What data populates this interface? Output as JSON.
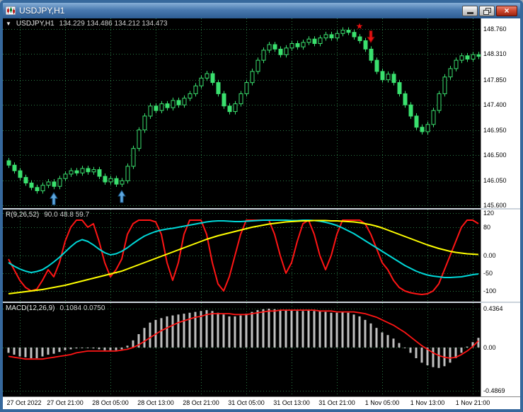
{
  "window": {
    "title": "USDJPY,H1",
    "close_glyph": "×"
  },
  "chart": {
    "collapse_icon": "▼",
    "symbol": "USDJPY,H1",
    "ohlc": "134.229 134.486 134.212 134.473"
  },
  "panes": {
    "osc": {
      "name": "R(9,26,52)",
      "values": "90.0 48.8 59.7"
    },
    "macd": {
      "name": "MACD(12,26,9)",
      "values": "0.1084 0.0750"
    }
  },
  "colors": {
    "grid": "#2a7a44",
    "candle": "#3ae06e",
    "osc_fast": "#ff1515",
    "osc_mid": "#00d8d8",
    "osc_slow": "#ffff00",
    "histogram": "#c0c0c0",
    "signal": "#ff1515",
    "buy_arrow": "#5fa8e0",
    "sell_arrow": "#e81111",
    "titlebar": "#3a6ba1",
    "background": "#000000"
  },
  "chart_data": [
    {
      "type": "candlestick",
      "title": "USDJPY,H1",
      "x_labels": [
        "27 Oct 2022",
        "27 Oct 21:00",
        "28 Oct 05:00",
        "28 Oct 13:00",
        "28 Oct 21:00",
        "31 Oct 05:00",
        "31 Oct 13:00",
        "31 Oct 21:00",
        "1 Nov 05:00",
        "1 Nov 13:00",
        "1 Nov 21:00"
      ],
      "x_label_bars": [
        2,
        10,
        18,
        26,
        34,
        42,
        50,
        58,
        66,
        74,
        82
      ],
      "y_ticks": [
        "148.760",
        "148.310",
        "147.850",
        "147.400",
        "146.950",
        "146.500",
        "146.050",
        "145.600"
      ],
      "y_range": [
        145.55,
        148.95
      ],
      "open_first": 146.4,
      "wick": 0.05,
      "closes": [
        146.32,
        146.22,
        146.1,
        146.0,
        145.92,
        145.86,
        145.96,
        146.02,
        145.94,
        146.08,
        146.16,
        146.22,
        146.18,
        146.26,
        146.2,
        146.24,
        146.12,
        146.02,
        146.08,
        145.98,
        146.04,
        146.3,
        146.62,
        146.95,
        147.2,
        147.38,
        147.3,
        147.42,
        147.35,
        147.48,
        147.4,
        147.52,
        147.6,
        147.74,
        147.88,
        147.96,
        147.8,
        147.6,
        147.38,
        147.28,
        147.42,
        147.6,
        147.8,
        148.0,
        148.2,
        148.38,
        148.48,
        148.4,
        148.3,
        148.42,
        148.5,
        148.44,
        148.52,
        148.58,
        148.5,
        148.6,
        148.66,
        148.6,
        148.68,
        148.74,
        148.7,
        148.62,
        148.55,
        148.4,
        148.2,
        148.0,
        147.85,
        147.95,
        147.8,
        147.6,
        147.4,
        147.2,
        147.0,
        146.92,
        147.05,
        147.3,
        147.6,
        147.9,
        148.05,
        148.2,
        148.28,
        148.22,
        148.3,
        148.27
      ],
      "markers": [
        {
          "type": "buy-arrow",
          "bar": 8,
          "color": "#5fa8e0"
        },
        {
          "type": "buy-arrow",
          "bar": 20,
          "color": "#5fa8e0"
        },
        {
          "type": "star",
          "bar": 62,
          "color": "#e81111",
          "glyph": "★"
        },
        {
          "type": "sell-arrow",
          "bar": 64,
          "color": "#e81111"
        }
      ]
    },
    {
      "type": "line",
      "label": "R(9,26,52)",
      "current_values": "90.0 48.8 59.7",
      "y_ticks": [
        "120",
        "80",
        "0.00",
        "-50",
        "-100"
      ],
      "y_range": [
        -130,
        130
      ],
      "series": [
        {
          "name": "fast",
          "color": "#ff1515",
          "values": [
            -10,
            -40,
            -70,
            -90,
            -100,
            -95,
            -70,
            -40,
            -60,
            -20,
            40,
            80,
            100,
            100,
            80,
            90,
            40,
            -20,
            -60,
            -40,
            -10,
            60,
            90,
            100,
            100,
            100,
            95,
            60,
            -20,
            -70,
            -20,
            60,
            100,
            100,
            100,
            60,
            -20,
            -80,
            -100,
            -60,
            0,
            60,
            100,
            100,
            100,
            100,
            100,
            60,
            0,
            -50,
            -20,
            40,
            90,
            100,
            60,
            0,
            -40,
            0,
            60,
            100,
            100,
            100,
            100,
            90,
            60,
            20,
            -20,
            -40,
            -70,
            -90,
            -100,
            -105,
            -108,
            -110,
            -108,
            -100,
            -80,
            -40,
            0,
            40,
            80,
            100,
            100,
            90
          ]
        },
        {
          "name": "mid",
          "color": "#00d8d8",
          "values": [
            -20,
            -30,
            -38,
            -44,
            -48,
            -45,
            -40,
            -30,
            -18,
            -5,
            10,
            25,
            38,
            45,
            40,
            30,
            18,
            8,
            2,
            5,
            12,
            22,
            34,
            45,
            55,
            62,
            68,
            72,
            75,
            77,
            80,
            83,
            86,
            89,
            92,
            95,
            97,
            98,
            98,
            97,
            96,
            96,
            97,
            98,
            99,
            100,
            100,
            100,
            100,
            100,
            99,
            99,
            100,
            100,
            99,
            97,
            94,
            90,
            85,
            78,
            70,
            62,
            52,
            42,
            32,
            22,
            12,
            2,
            -8,
            -18,
            -28,
            -36,
            -44,
            -50,
            -55,
            -58,
            -60,
            -62,
            -62,
            -61,
            -60,
            -57,
            -54,
            -52
          ]
        },
        {
          "name": "slow",
          "color": "#ffff00",
          "values": [
            -108,
            -106,
            -104,
            -102,
            -100,
            -98,
            -96,
            -93,
            -90,
            -87,
            -84,
            -80,
            -76,
            -72,
            -68,
            -64,
            -60,
            -56,
            -52,
            -48,
            -44,
            -38,
            -32,
            -26,
            -20,
            -14,
            -8,
            -2,
            4,
            10,
            16,
            22,
            28,
            34,
            40,
            46,
            51,
            56,
            60,
            64,
            68,
            72,
            76,
            80,
            83,
            86,
            89,
            91,
            93,
            95,
            96,
            97,
            98,
            98,
            99,
            99,
            99,
            98,
            98,
            97,
            96,
            95,
            93,
            90,
            87,
            83,
            78,
            72,
            66,
            60,
            54,
            48,
            42,
            36,
            30,
            25,
            20,
            16,
            12,
            9,
            7,
            5,
            4,
            3
          ]
        }
      ]
    },
    {
      "type": "macd",
      "label": "MACD(12,26,9)",
      "current_values": "0.1084 0.0750",
      "y_ticks": [
        "0.4364",
        "0.00",
        "-0.4869"
      ],
      "y_range": [
        -0.55,
        0.5
      ],
      "histogram": {
        "color": "#c0c0c0",
        "values": [
          -0.06,
          -0.08,
          -0.1,
          -0.11,
          -0.12,
          -0.12,
          -0.1,
          -0.08,
          -0.07,
          -0.05,
          -0.03,
          -0.02,
          -0.01,
          0.0,
          0.0,
          -0.01,
          -0.02,
          -0.03,
          -0.03,
          -0.03,
          -0.02,
          0.02,
          0.08,
          0.15,
          0.22,
          0.28,
          0.31,
          0.33,
          0.35,
          0.36,
          0.37,
          0.38,
          0.39,
          0.4,
          0.41,
          0.42,
          0.41,
          0.39,
          0.37,
          0.35,
          0.35,
          0.36,
          0.38,
          0.4,
          0.42,
          0.43,
          0.4364,
          0.43,
          0.42,
          0.42,
          0.42,
          0.41,
          0.41,
          0.42,
          0.41,
          0.41,
          0.4,
          0.39,
          0.39,
          0.4,
          0.39,
          0.37,
          0.35,
          0.31,
          0.27,
          0.22,
          0.17,
          0.14,
          0.1,
          0.05,
          0.0,
          -0.06,
          -0.12,
          -0.17,
          -0.2,
          -0.22,
          -0.23,
          -0.21,
          -0.17,
          -0.12,
          -0.06,
          0.01,
          0.06,
          0.1084
        ]
      },
      "signal": {
        "color": "#ff1515",
        "values": [
          -0.1,
          -0.11,
          -0.12,
          -0.13,
          -0.13,
          -0.13,
          -0.13,
          -0.12,
          -0.11,
          -0.1,
          -0.09,
          -0.08,
          -0.06,
          -0.05,
          -0.04,
          -0.04,
          -0.04,
          -0.04,
          -0.04,
          -0.04,
          -0.03,
          -0.02,
          0.0,
          0.03,
          0.07,
          0.11,
          0.15,
          0.19,
          0.22,
          0.25,
          0.28,
          0.3,
          0.32,
          0.34,
          0.35,
          0.37,
          0.38,
          0.38,
          0.38,
          0.38,
          0.37,
          0.37,
          0.37,
          0.38,
          0.39,
          0.4,
          0.41,
          0.41,
          0.42,
          0.42,
          0.42,
          0.42,
          0.42,
          0.42,
          0.42,
          0.41,
          0.41,
          0.41,
          0.4,
          0.4,
          0.4,
          0.4,
          0.39,
          0.38,
          0.36,
          0.34,
          0.31,
          0.28,
          0.25,
          0.21,
          0.17,
          0.12,
          0.07,
          0.02,
          -0.02,
          -0.06,
          -0.09,
          -0.11,
          -0.12,
          -0.11,
          -0.08,
          -0.04,
          0.01,
          0.075
        ]
      }
    }
  ]
}
